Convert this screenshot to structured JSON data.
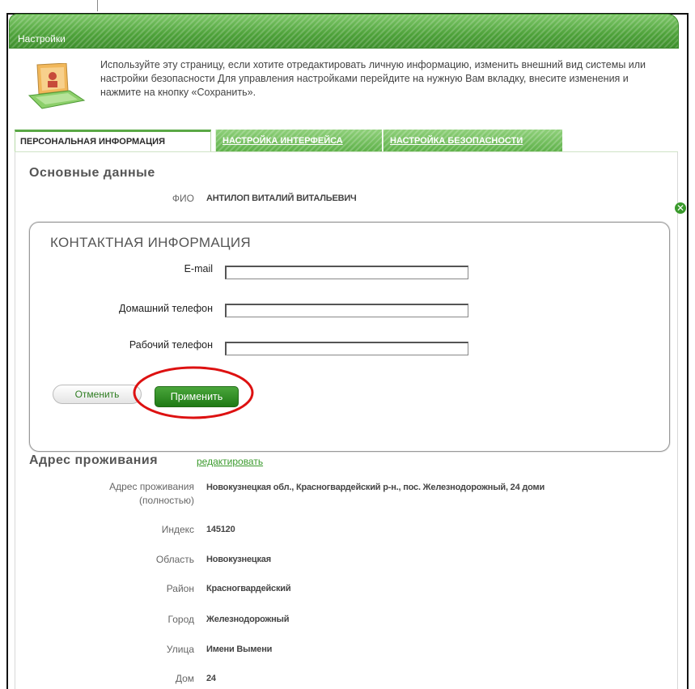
{
  "window": {
    "title": "Настройки"
  },
  "intro": {
    "text": "Используйте эту страницу, если хотите отредактировать личную информацию, изменить внешний вид системы или настройки безопасности Для управления настройками перейдите на нужную Вам вкладку, внесите изменения и нажмите на кнопку «Сохранить».",
    "icon": "settings-laptop-icon"
  },
  "tabs": [
    {
      "label": "ПЕРСОНАЛЬНАЯ ИНФОРМАЦИЯ",
      "active": true
    },
    {
      "label": "НАСТРОЙКА ИНТЕРФЕЙСА",
      "active": false
    },
    {
      "label": "НАСТРОЙКА БЕЗОПАСНОСТИ",
      "active": false
    }
  ],
  "main": {
    "title": "Основные данные",
    "fio_label": "ФИО",
    "fio_value": "АНТИЛОП ВИТАЛИЙ ВИТАЛЬЕВИЧ"
  },
  "dialog": {
    "title": "КОНТАКТНАЯ ИНФОРМАЦИЯ",
    "fields": [
      {
        "label": "E-mail",
        "value": ""
      },
      {
        "label": "Домашний телефон",
        "value": ""
      },
      {
        "label": "Рабочий телефон",
        "value": ""
      }
    ],
    "cancel_label": "Отменить",
    "apply_label": "Применить"
  },
  "address": {
    "title": "Адрес проживания",
    "edit_label": "редактировать",
    "rows": [
      {
        "label": "Адрес проживания (полностью)",
        "value": "Новокузнецкая обл., Красногвардейский р-н., пос. Железнодорожный, 24 доми"
      },
      {
        "label": "Индекс",
        "value": "145120"
      },
      {
        "label": "Область",
        "value": "Новокузнецкая"
      },
      {
        "label": "Район",
        "value": "Красногвардейский"
      },
      {
        "label": "Город",
        "value": "Железнодорожный"
      },
      {
        "label": "Улица",
        "value": "Имени Вымени"
      },
      {
        "label": "Дом",
        "value": "24"
      }
    ]
  },
  "colors": {
    "accent": "#4ea23a",
    "highlight": "#dd1111",
    "link": "#3a9a2c"
  }
}
